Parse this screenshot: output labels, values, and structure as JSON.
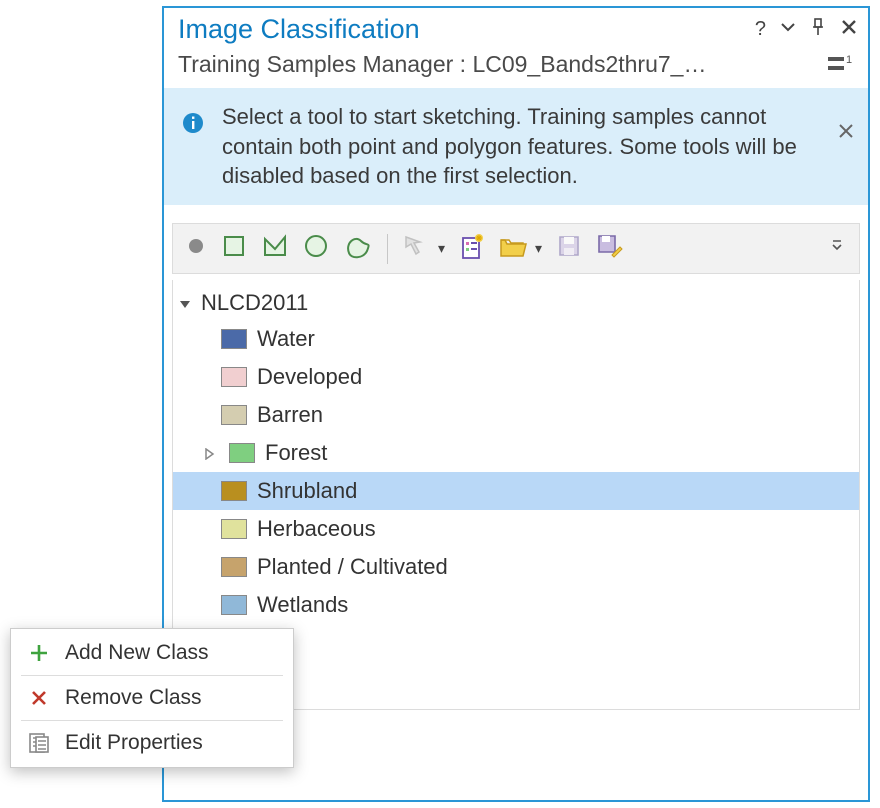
{
  "header": {
    "title": "Image Classification",
    "subtitle": "Training Samples Manager : LC09_Bands2thru7_…"
  },
  "info": {
    "message": "Select a tool to start sketching. Training samples cannot contain both point and polygon features. Some tools will be disabled based on the first selection."
  },
  "tree": {
    "root": "NLCD2011",
    "classes": [
      {
        "label": "Water",
        "color": "#4b6aa8",
        "selected": false,
        "hasChildren": false
      },
      {
        "label": "Developed",
        "color": "#f1cfd0",
        "selected": false,
        "hasChildren": false
      },
      {
        "label": "Barren",
        "color": "#d4cdb0",
        "selected": false,
        "hasChildren": false
      },
      {
        "label": "Forest",
        "color": "#7fcf80",
        "selected": false,
        "hasChildren": true
      },
      {
        "label": "Shrubland",
        "color": "#b98f1f",
        "selected": true,
        "hasChildren": false
      },
      {
        "label": "Herbaceous",
        "color": "#e0e29d",
        "selected": false,
        "hasChildren": false,
        "truncated": "baceous"
      },
      {
        "label": "Planted / Cultivated",
        "color": "#c6a36c",
        "selected": false,
        "hasChildren": false,
        "truncated": "nted / Cultivated"
      },
      {
        "label": "Wetlands",
        "color": "#90b8d8",
        "selected": false,
        "hasChildren": false,
        "truncated": "tlands"
      }
    ]
  },
  "context_menu": {
    "items": [
      {
        "label": "Add New Class",
        "icon": "plus",
        "key": "add"
      },
      {
        "label": "Remove Class",
        "icon": "x",
        "key": "remove"
      },
      {
        "label": "Edit Properties",
        "icon": "props",
        "key": "edit"
      }
    ]
  }
}
